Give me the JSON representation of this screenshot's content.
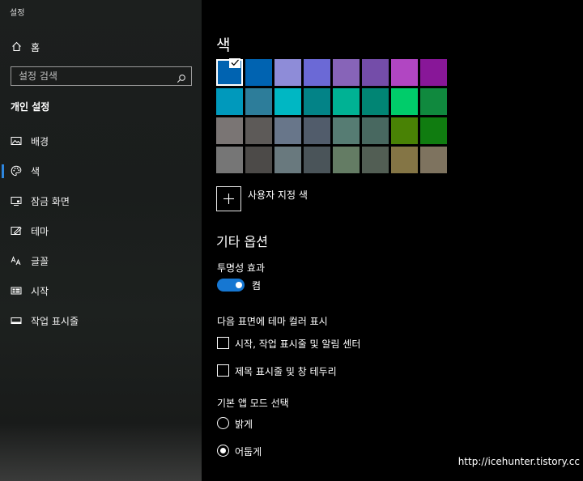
{
  "window": {
    "title": "설정"
  },
  "sidebar": {
    "home_label": "홈",
    "search_placeholder": "설정 검색",
    "section_title": "개인 설정",
    "items": [
      {
        "label": "배경",
        "icon": "picture-icon"
      },
      {
        "label": "색",
        "icon": "palette-icon",
        "active": true
      },
      {
        "label": "잠금 화면",
        "icon": "lock-screen-icon"
      },
      {
        "label": "테마",
        "icon": "theme-icon"
      },
      {
        "label": "글꼴",
        "icon": "font-icon"
      },
      {
        "label": "시작",
        "icon": "start-icon"
      },
      {
        "label": "작업 표시줄",
        "icon": "taskbar-icon"
      }
    ]
  },
  "main": {
    "title": "색",
    "swatches": [
      [
        "#0063b1",
        "#0063b1",
        "#8e8cd8",
        "#6b69d6",
        "#8764b8",
        "#744da9",
        "#b146c2",
        "#881798"
      ],
      [
        "#0099bc",
        "#2d7d9a",
        "#00b7c3",
        "#038387",
        "#00b294",
        "#018574",
        "#00cc6a",
        "#10893e"
      ],
      [
        "#7a7574",
        "#5d5a58",
        "#68768a",
        "#515c6b",
        "#567c73",
        "#486860",
        "#498205",
        "#107c10"
      ],
      [
        "#767676",
        "#4c4a48",
        "#69797e",
        "#4a5459",
        "#647c64",
        "#525e54",
        "#847545",
        "#7e735f"
      ]
    ],
    "selected_swatch": "0-0",
    "custom_color_label": "사용자 지정 색",
    "other_options_title": "기타 옵션",
    "transparency_label": "투명성 효과",
    "transparency_state": "켬",
    "accent_surfaces_label": "다음 표면에 테마 컬러 표시",
    "checkbox_start_label": "시작, 작업 표시줄 및 알림 센터",
    "checkbox_titlebar_label": "제목 표시줄 및 창 테두리",
    "app_mode_label": "기본 앱 모드 선택",
    "radio_light_label": "밝게",
    "radio_dark_label": "어둡게",
    "app_mode_selected": "어둡게"
  },
  "watermark": "http://icehunter.tistory.cc",
  "colors": {
    "accent": "#1677d2",
    "sidebar_bg": "#1c1f1e",
    "main_bg": "#000000"
  }
}
